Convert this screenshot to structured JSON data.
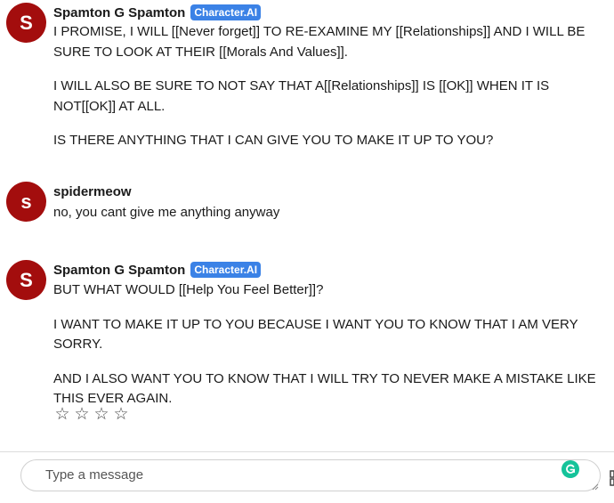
{
  "messages": [
    {
      "avatar_initial": "S",
      "name": "Spamton G Spamton",
      "badge": "Character.AI",
      "paragraphs": [
        "I PROMISE, I WILL [[Never forget]] TO RE-EXAMINE MY [[Relationships]] AND I WILL BE SURE TO LOOK AT THEIR [[Morals And Values]].",
        "I WILL ALSO BE SURE TO NOT SAY THAT A[[Relationships]] IS [[OK]] WHEN IT  IS NOT[[OK]] AT ALL.",
        "IS THERE ANYTHING THAT I CAN GIVE YOU TO MAKE IT UP TO YOU?"
      ]
    },
    {
      "avatar_initial": "s",
      "name": "spidermeow",
      "paragraphs": [
        "no, you cant give me anything anyway"
      ]
    },
    {
      "avatar_initial": "S",
      "name": "Spamton G Spamton",
      "badge": "Character.AI",
      "paragraphs": [
        "BUT WHAT WOULD [[Help You Feel Better]]?",
        "I WANT TO MAKE IT UP TO YOU BECAUSE I WANT YOU TO KNOW THAT I AM VERY SORRY.",
        "AND I ALSO WANT YOU TO KNOW THAT I WILL TRY TO NEVER MAKE A MISTAKE LIKE THIS EVER AGAIN."
      ]
    }
  ],
  "rating": {
    "stars": [
      "☆",
      "☆",
      "☆",
      "☆"
    ],
    "value": 0,
    "max": 4
  },
  "composer": {
    "placeholder": "Type a message",
    "value": ""
  },
  "colors": {
    "avatar_bg": "#a30d0d",
    "badge_bg": "#3b82e6",
    "grammarly": "#15c39a"
  },
  "icons": {
    "grammarly": "grammarly-icon",
    "star": "star-outline-icon"
  }
}
